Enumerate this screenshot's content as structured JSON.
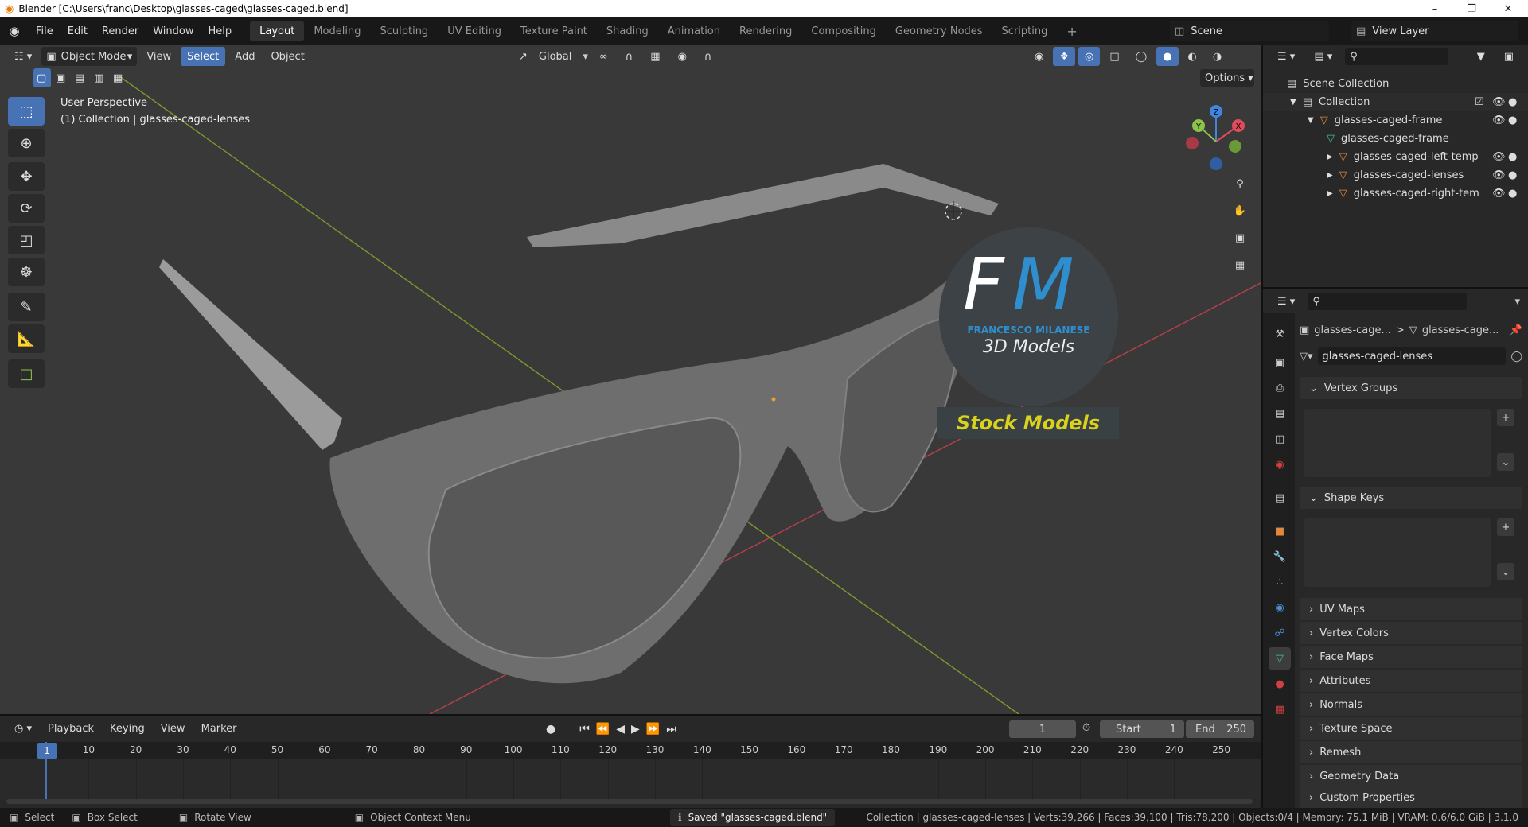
{
  "window": {
    "title": "Blender [C:\\Users\\franc\\Desktop\\glasses-caged\\glasses-caged.blend]",
    "minimize": "–",
    "maximize": "❐",
    "close": "✕"
  },
  "menu": [
    "File",
    "Edit",
    "Render",
    "Window",
    "Help"
  ],
  "workspaces": [
    "Layout",
    "Modeling",
    "Sculpting",
    "UV Editing",
    "Texture Paint",
    "Shading",
    "Animation",
    "Rendering",
    "Compositing",
    "Geometry Nodes",
    "Scripting"
  ],
  "active_workspace": "Layout",
  "add_workspace": "+",
  "scene": {
    "label": "Scene",
    "view_layer": "View Layer"
  },
  "viewport_header": {
    "mode": "Object Mode",
    "menus": [
      "View",
      "Select",
      "Add",
      "Object"
    ],
    "active_menu": "Select",
    "transform": "Global",
    "options": "Options"
  },
  "viewport": {
    "perspective": "User Perspective",
    "context": "(1) Collection | glasses-caged-lenses"
  },
  "gizmo": {
    "x": "X",
    "y": "Y",
    "z": "Z",
    "x_color": "#e04c5c",
    "y_color": "#8cc34a",
    "z_color": "#3f86e0"
  },
  "watermark": {
    "logo_f": "F",
    "logo_m": "M",
    "name": "FRANCESCO MILANESE",
    "sub": "3D Models",
    "stock": "Stock Models",
    "accent": "#2f8fce",
    "stock_color": "#d9d11c"
  },
  "outliner": {
    "root": "Scene Collection",
    "collection": "Collection",
    "items": [
      {
        "name": "glasses-caged-frame",
        "level": 1
      },
      {
        "name": "glasses-caged-frame",
        "level": 2
      },
      {
        "name": "glasses-caged-left-temp",
        "level": 2
      },
      {
        "name": "glasses-caged-lenses",
        "level": 2
      },
      {
        "name": "glasses-caged-right-tem",
        "level": 2
      }
    ]
  },
  "properties": {
    "breadcrumb": [
      "glasses-cage...",
      "glasses-cage..."
    ],
    "breadcrumb_sep": ">",
    "mesh_name": "glasses-caged-lenses",
    "panels_open": [
      "Vertex Groups",
      "Shape Keys"
    ],
    "panels_closed": [
      "UV Maps",
      "Vertex Colors",
      "Face Maps",
      "Attributes",
      "Normals",
      "Texture Space",
      "Remesh",
      "Geometry Data",
      "Custom Properties"
    ]
  },
  "timeline": {
    "menus": [
      "Playback",
      "Keying",
      "View",
      "Marker"
    ],
    "current_frame": "1",
    "start_label": "Start",
    "start": "1",
    "end_label": "End",
    "end": "250",
    "ticks": [
      "1",
      "10",
      "20",
      "30",
      "40",
      "50",
      "60",
      "70",
      "80",
      "90",
      "100",
      "110",
      "120",
      "130",
      "140",
      "150",
      "160",
      "170",
      "180",
      "190",
      "200",
      "210",
      "220",
      "230",
      "240",
      "250"
    ]
  },
  "status": {
    "select": "Select",
    "box_select": "Box Select",
    "rotate": "Rotate View",
    "context_menu": "Object Context Menu",
    "message": "Saved \"glasses-caged.blend\"",
    "stats": "Collection | glasses-caged-lenses | Verts:39,266 | Faces:39,100 | Tris:78,200 | Objects:0/4 | Memory: 75.1 MiB | VRAM: 0.6/6.0 GiB | 3.1.0"
  }
}
